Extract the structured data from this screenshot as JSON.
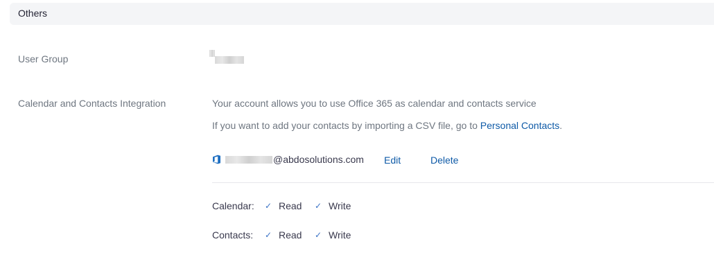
{
  "section": {
    "title": "Others"
  },
  "user_group": {
    "label": "User Group"
  },
  "integration": {
    "label": "Calendar and Contacts Integration",
    "description": "Your account allows you to use Office 365 as calendar and contacts service",
    "csv_prefix": "If you want to add your contacts by importing a CSV file, go to ",
    "csv_link": "Personal Contacts",
    "csv_suffix": ".",
    "account": {
      "icon": "office365-icon",
      "email_domain": "@abdosolutions.com",
      "edit_label": "Edit",
      "delete_label": "Delete"
    },
    "permissions": {
      "calendar": {
        "label": "Calendar:",
        "read": "Read",
        "write": "Write"
      },
      "contacts": {
        "label": "Contacts:",
        "read": "Read",
        "write": "Write"
      }
    }
  },
  "colors": {
    "link": "#0e5aa7",
    "check": "#3b73c6",
    "office_icon": "#1e6fc1"
  }
}
